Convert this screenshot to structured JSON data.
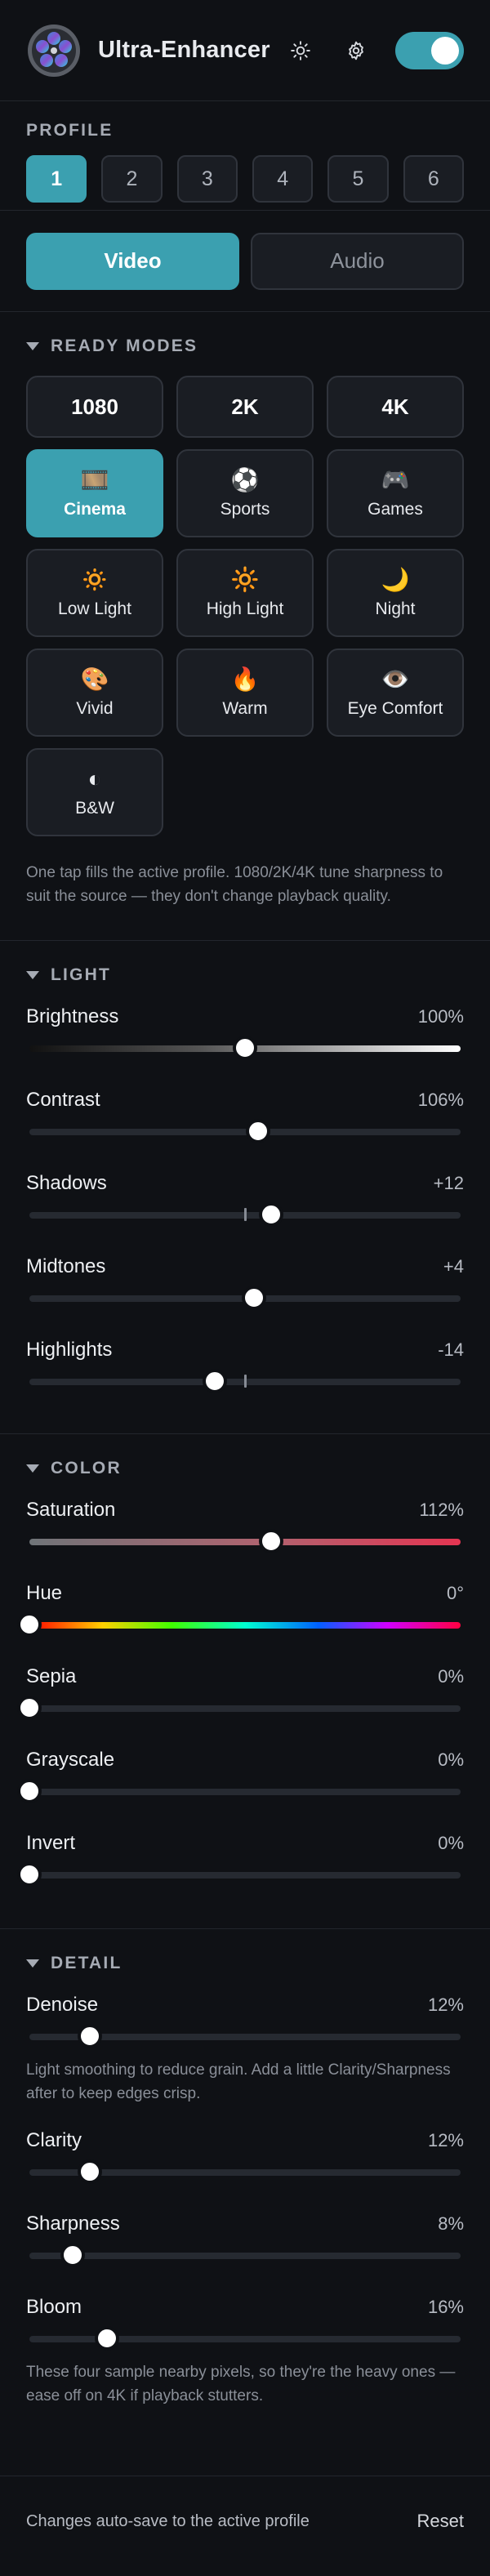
{
  "header": {
    "title": "Ultra-Enhancer",
    "toggle_on": true
  },
  "profile": {
    "label": "PROFILE",
    "options": [
      "1",
      "2",
      "3",
      "4",
      "5",
      "6"
    ],
    "active": "1"
  },
  "mode": {
    "video_label": "Video",
    "audio_label": "Audio",
    "active": "Video"
  },
  "ready_modes": {
    "label": "READY MODES",
    "resolutions": [
      "1080",
      "2K",
      "4K"
    ],
    "presets": [
      {
        "label": "Cinema",
        "icon": "film-icon",
        "glyph": "🎞️",
        "active": true
      },
      {
        "label": "Sports",
        "icon": "soccer-ball-icon",
        "glyph": "⚽"
      },
      {
        "label": "Games",
        "icon": "gamepad-icon",
        "glyph": "🎮"
      },
      {
        "label": "Low Light",
        "icon": "dim-sun-icon",
        "glyph": "🔅"
      },
      {
        "label": "High Light",
        "icon": "bright-sun-icon",
        "glyph": "🔆"
      },
      {
        "label": "Night",
        "icon": "crescent-moon-icon",
        "glyph": "🌙"
      },
      {
        "label": "Vivid",
        "icon": "palette-icon",
        "glyph": "🎨"
      },
      {
        "label": "Warm",
        "icon": "flame-icon",
        "glyph": "🔥"
      },
      {
        "label": "Eye Comfort",
        "icon": "eye-icon",
        "glyph": "👁️"
      },
      {
        "label": "B&W",
        "icon": "half-circle-icon",
        "glyph": "◐"
      }
    ],
    "hint": "One tap fills the active profile. 1080/2K/4K tune sharpness to suit the source — they don't change playback quality."
  },
  "light": {
    "label": "LIGHT",
    "sliders": [
      {
        "name": "Brightness",
        "value": "100%",
        "fraction": 0.5,
        "track": "bright"
      },
      {
        "name": "Contrast",
        "value": "106%",
        "fraction": 0.53
      },
      {
        "name": "Shadows",
        "value": "+12",
        "fraction": 0.56,
        "center_tick": true
      },
      {
        "name": "Midtones",
        "value": "+4",
        "fraction": 0.52
      },
      {
        "name": "Highlights",
        "value": "-14",
        "fraction": 0.43,
        "center_tick": true
      }
    ]
  },
  "color": {
    "label": "COLOR",
    "sliders": [
      {
        "name": "Saturation",
        "value": "112%",
        "fraction": 0.56,
        "track": "sat"
      },
      {
        "name": "Hue",
        "value": "0°",
        "fraction": 0.0,
        "track": "hue"
      },
      {
        "name": "Sepia",
        "value": "0%",
        "fraction": 0.0
      },
      {
        "name": "Grayscale",
        "value": "0%",
        "fraction": 0.0
      },
      {
        "name": "Invert",
        "value": "0%",
        "fraction": 0.0
      }
    ]
  },
  "detail": {
    "label": "DETAIL",
    "sliders": [
      {
        "name": "Denoise",
        "value": "12%",
        "fraction": 0.14,
        "hint": "Light smoothing to reduce grain. Add a little Clarity/Sharpness after to keep edges crisp."
      },
      {
        "name": "Clarity",
        "value": "12%",
        "fraction": 0.14
      },
      {
        "name": "Sharpness",
        "value": "8%",
        "fraction": 0.1
      },
      {
        "name": "Bloom",
        "value": "16%",
        "fraction": 0.18,
        "hint": "These four sample nearby pixels, so they're the heavy ones — ease off on 4K if playback stutters."
      }
    ]
  },
  "footer": {
    "note": "Changes auto-save to the active profile",
    "reset_label": "Reset"
  },
  "colors": {
    "accent": "#3ba0b0",
    "background": "#0f1115",
    "surface": "#1a1d23"
  }
}
